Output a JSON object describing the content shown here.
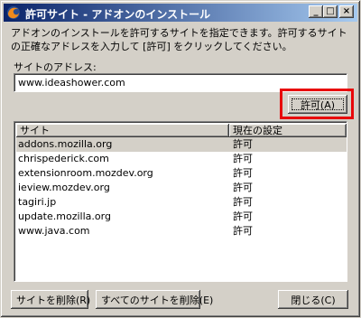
{
  "window": {
    "title": "許可サイト - アドオンのインストール",
    "buttons": {
      "minimize": "_",
      "maximize": "□",
      "close": "×"
    }
  },
  "description": "アドオンのインストールを許可するサイトを指定できます。許可するサイトの正確なアドレスを入力して [許可] をクリックしてください。",
  "address": {
    "label": "サイトのアドレス:",
    "value": "www.ideashower.com"
  },
  "allow_button": "許可(A)",
  "list": {
    "columns": [
      "サイト",
      "現在の設定"
    ],
    "rows": [
      {
        "site": "addons.mozilla.org",
        "status": "許可",
        "selected": true
      },
      {
        "site": "chrispederick.com",
        "status": "許可"
      },
      {
        "site": "extensionroom.mozdev.org",
        "status": "許可"
      },
      {
        "site": "ieview.mozdev.org",
        "status": "許可"
      },
      {
        "site": "tagiri.jp",
        "status": "許可"
      },
      {
        "site": "update.mozilla.org",
        "status": "許可"
      },
      {
        "site": "www.java.com",
        "status": "許可"
      }
    ]
  },
  "footer": {
    "remove_site": "サイトを削除(R)",
    "remove_all": "すべてのサイトを削除(E)",
    "close": "閉じる(C)"
  },
  "colors": {
    "highlight": "#e8070a",
    "titlebar_start": "#0a246a",
    "titlebar_end": "#a6caf0",
    "face": "#d4d0c8"
  }
}
